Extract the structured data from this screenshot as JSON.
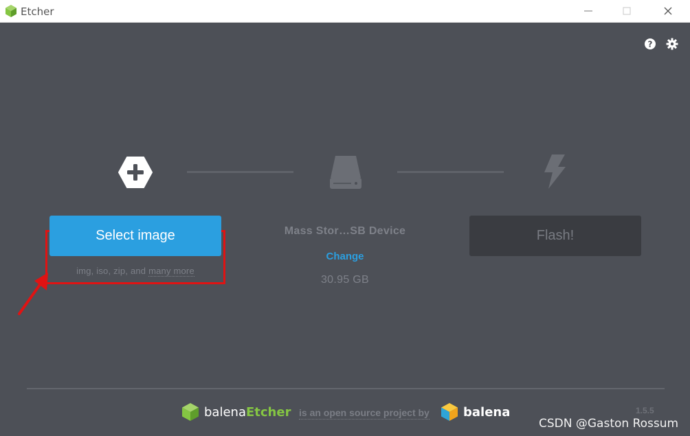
{
  "window": {
    "title": "Etcher",
    "icon": "etcher-cube-icon"
  },
  "header_icons": {
    "help": "help-icon",
    "settings": "gear-icon"
  },
  "steps": {
    "image": {
      "icon": "plus-hexagon-icon",
      "button_label": "Select image",
      "hint_prefix": "img, iso, zip, and",
      "hint_link": "many more"
    },
    "drive": {
      "icon": "drive-icon",
      "name": "Mass Stor…SB Device",
      "change_label": "Change",
      "size": "30.95 GB"
    },
    "flash": {
      "icon": "lightning-icon",
      "button_label": "Flash!"
    }
  },
  "footer": {
    "brand_prefix": "balena",
    "brand_suffix": "Etcher",
    "tagline": "is an open source project by",
    "company": "balena",
    "version": "1.5.5"
  },
  "watermark": "CSDN @Gaston Rossum",
  "colors": {
    "background": "#4d5057",
    "accent": "#2b9fe0",
    "annotation_red": "#e01313",
    "etcher_green": "#85c643"
  }
}
